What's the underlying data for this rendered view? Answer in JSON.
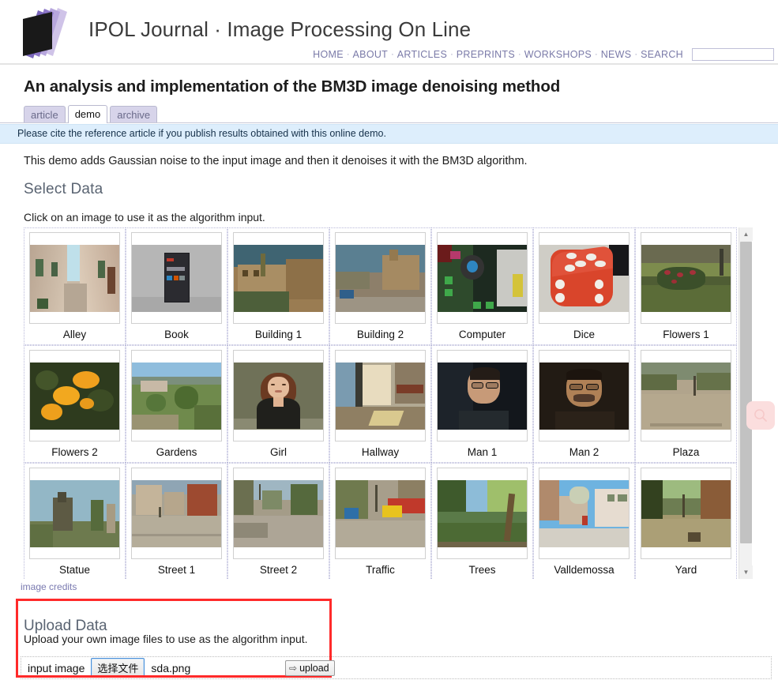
{
  "header": {
    "brand": "IPOL Journal · Image Processing On Line",
    "logo_icon": "ipol-stacked-layers-logo",
    "nav": [
      {
        "label": "HOME"
      },
      {
        "label": "ABOUT"
      },
      {
        "label": "ARTICLES"
      },
      {
        "label": "PREPRINTS"
      },
      {
        "label": "WORKSHOPS"
      },
      {
        "label": "NEWS"
      },
      {
        "label": "SEARCH"
      }
    ],
    "nav_separator": "·",
    "search": {
      "value": "",
      "placeholder": ""
    }
  },
  "page": {
    "title": "An analysis and implementation of the BM3D image denoising method",
    "tabs": [
      {
        "label": "article",
        "active": false
      },
      {
        "label": "demo",
        "active": true
      },
      {
        "label": "archive",
        "active": false
      }
    ],
    "notice": "Please cite the reference article if you publish results obtained with this online demo.",
    "intro": "This demo adds Gaussian noise to the input image and then it denoises it with the BM3D algorithm."
  },
  "select_data": {
    "heading": "Select Data",
    "hint": "Click on an image to use it as the algorithm input.",
    "credits_link": "image credits",
    "items": [
      {
        "label": "Alley"
      },
      {
        "label": "Book"
      },
      {
        "label": "Building 1"
      },
      {
        "label": "Building 2"
      },
      {
        "label": "Computer"
      },
      {
        "label": "Dice"
      },
      {
        "label": "Flowers 1"
      },
      {
        "label": "Flowers 2"
      },
      {
        "label": "Gardens"
      },
      {
        "label": "Girl"
      },
      {
        "label": "Hallway"
      },
      {
        "label": "Man 1"
      },
      {
        "label": "Man 2"
      },
      {
        "label": "Plaza"
      },
      {
        "label": "Statue"
      },
      {
        "label": "Street 1"
      },
      {
        "label": "Street 2"
      },
      {
        "label": "Traffic"
      },
      {
        "label": "Trees"
      },
      {
        "label": "Valldemossa"
      },
      {
        "label": "Yard"
      }
    ],
    "scrollbar": {
      "up_icon": "caret-up-icon",
      "down_icon": "caret-down-icon"
    }
  },
  "upload": {
    "heading": "Upload Data",
    "subtitle": "Upload your own image files to use as the algorithm input.",
    "field_label": "input image",
    "choose_file_button": "选择文件",
    "file_name": "sda.png",
    "upload_button": "upload",
    "upload_icon": "arrow-right-icon",
    "highlight_color": "#ff2a2a"
  },
  "overlay": {
    "magnifier_icon": "magnifier-icon"
  },
  "colors": {
    "tab_inactive_bg": "#d7d4ea",
    "notice_bg": "#ddeefc",
    "link_purple": "#7a7ab0",
    "heading_gray": "#5a6472"
  }
}
